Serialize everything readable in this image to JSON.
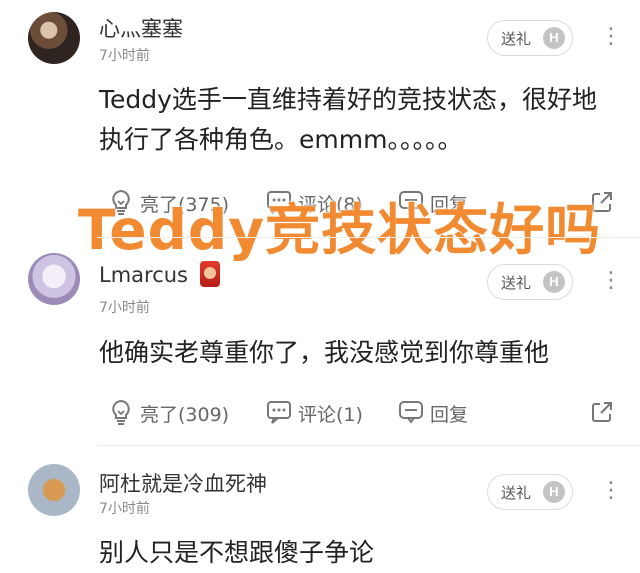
{
  "overlay_title": "Teddy竞技状态好吗",
  "comments": [
    {
      "username": "心灬塞塞",
      "time": "7小时前",
      "gift_label": "送礼",
      "gift_badge": "H",
      "text": "Teddy选手一直维持着好的竞技状态，很好地执行了各种角色。emmm。。。。。",
      "actions": {
        "like": "亮了(375)",
        "comment": "评论(8)",
        "reply": "回复"
      }
    },
    {
      "username": "Lmarcus",
      "time": "7小时前",
      "gift_label": "送礼",
      "gift_badge": "H",
      "text": "他确实老尊重你了，我没感觉到你尊重他",
      "actions": {
        "like": "亮了(309)",
        "comment": "评论(1)",
        "reply": "回复"
      }
    },
    {
      "username": "阿杜就是冷血死神",
      "time": "7小时前",
      "gift_label": "送礼",
      "gift_badge": "H",
      "text": "别人只是不想跟傻子争论"
    }
  ],
  "icons": {
    "like": "lightbulb-icon",
    "comment": "comment-bubble-icon",
    "reply": "reply-bubble-icon",
    "share": "share-icon",
    "more": "more-vertical-icon"
  }
}
